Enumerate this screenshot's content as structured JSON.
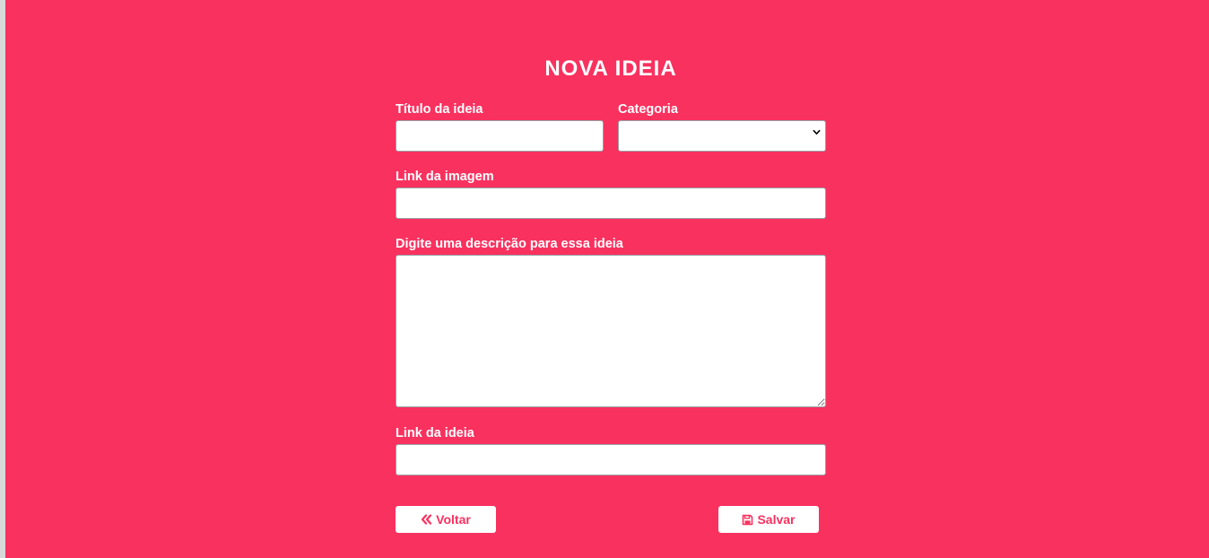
{
  "page": {
    "title": "NOVA IDEIA"
  },
  "form": {
    "title_label": "Título da ideia",
    "title_value": "",
    "category_label": "Categoria",
    "category_selected": "",
    "image_link_label": "Link da imagem",
    "image_link_value": "",
    "description_label": "Digite uma descrição para essa ideia",
    "description_value": "",
    "idea_link_label": "Link da ideia",
    "idea_link_value": ""
  },
  "buttons": {
    "back_label": "Voltar",
    "back_icon": "double-chevron-left-icon",
    "save_label": "Salvar",
    "save_icon": "floppy-disk-icon"
  },
  "colors": {
    "background": "#f9315f",
    "text_on_background": "#ffffff",
    "button_text": "#f9315f"
  }
}
